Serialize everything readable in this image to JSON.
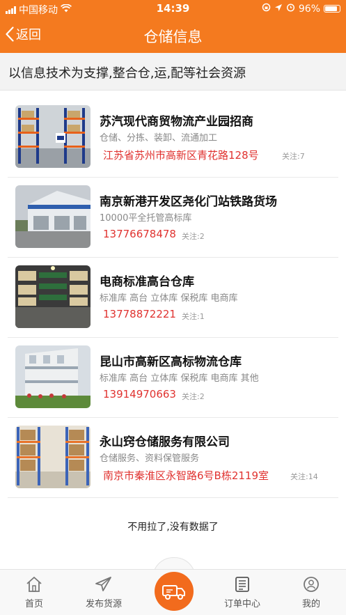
{
  "status_bar": {
    "carrier": "中国移动",
    "time": "14:39",
    "battery": "96%"
  },
  "nav": {
    "back_label": "返回",
    "title": "仓储信息"
  },
  "banner": {
    "text": "以信息技术为支撑,整合仓,运,配等社会资源"
  },
  "listings": [
    {
      "name": "苏汽现代商贸物流产业园招商",
      "tags": "仓储、分拣、装卸、流通加工",
      "contact": "江苏省苏州市高新区青花路128号",
      "follow": "关注:7"
    },
    {
      "name": "南京新港开发区尧化门站铁路货场",
      "tags": "10000平全托管高标库",
      "contact": "13776678478",
      "follow": "关注:2"
    },
    {
      "name": "电商标准高台仓库",
      "tags": "标准库 高台 立体库 保税库 电商库",
      "contact": "13778872221",
      "follow": "关注:1"
    },
    {
      "name": "昆山市高新区高标物流仓库",
      "tags": "标准库 高台 立体库 保税库 电商库 其他",
      "contact": "13914970663",
      "follow": "关注:2"
    },
    {
      "name": "永山窍仓储服务有限公司",
      "tags": "仓储服务、资料保管服务",
      "contact": "南京市秦淮区永智路6号B栋2119室",
      "follow": "关注:14"
    }
  ],
  "footer_note": "不用拉了,没有数据了",
  "tabbar": {
    "home": "首页",
    "publish": "发布货源",
    "orders": "订单中心",
    "mine": "我的"
  },
  "colors": {
    "brand": "#f47a1f",
    "contact": "#e0322f"
  }
}
